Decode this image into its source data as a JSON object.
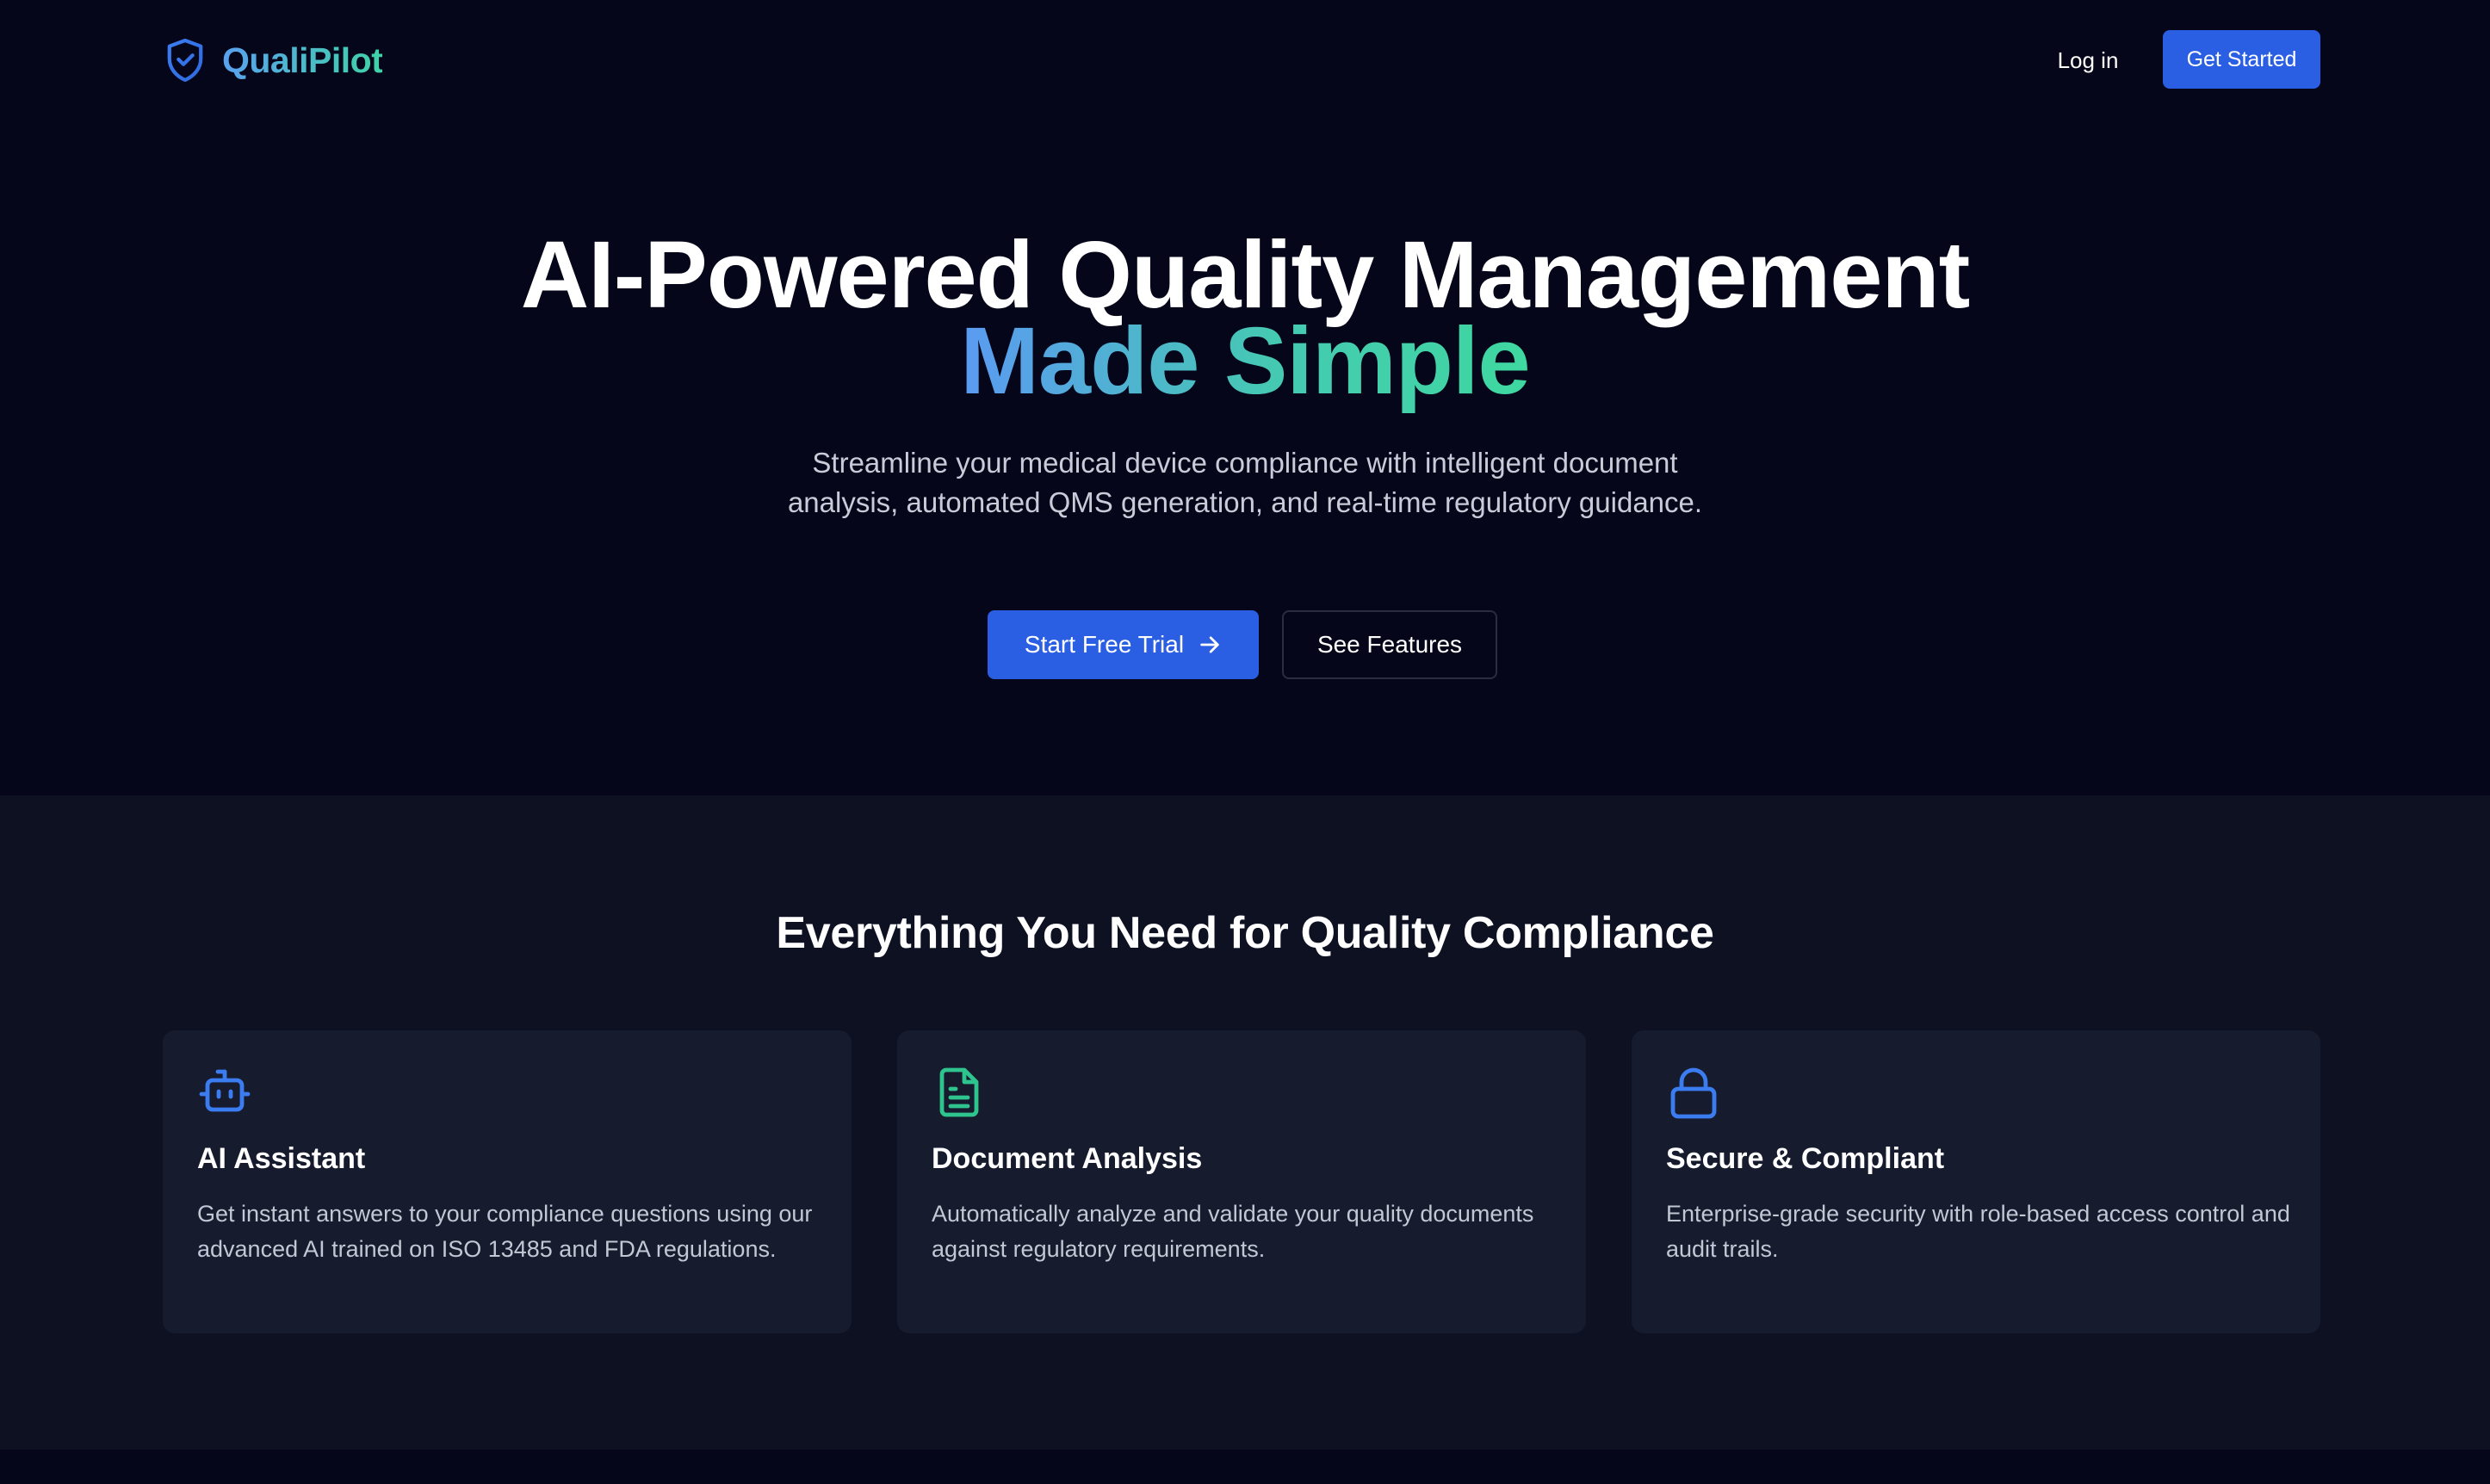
{
  "header": {
    "brand": "QualiPilot",
    "login_label": "Log in",
    "get_started_label": "Get Started"
  },
  "hero": {
    "title_line1": "AI-Powered Quality Management",
    "title_line2": "Made Simple",
    "subtitle": "Streamline your medical device compliance with intelligent document analysis, automated QMS generation, and real-time regulatory guidance.",
    "primary_cta": "Start Free Trial",
    "secondary_cta": "See Features"
  },
  "features": {
    "heading": "Everything You Need for Quality Compliance",
    "cards": [
      {
        "icon": "bot-icon",
        "title": "AI Assistant",
        "description": "Get instant answers to your compliance questions using our advanced AI trained on ISO 13485 and FDA regulations."
      },
      {
        "icon": "document-icon",
        "title": "Document Analysis",
        "description": "Automatically analyze and validate your quality documents against regulatory requirements."
      },
      {
        "icon": "lock-icon",
        "title": "Secure & Compliant",
        "description": "Enterprise-grade security with role-based access control and audit trails."
      }
    ]
  },
  "colors": {
    "background": "#05061a",
    "section_background": "#0d1122",
    "card_background": "#161b2e",
    "primary": "#2b5fe3",
    "gradient_start": "#5b9af2",
    "gradient_end": "#3fd8a0"
  }
}
